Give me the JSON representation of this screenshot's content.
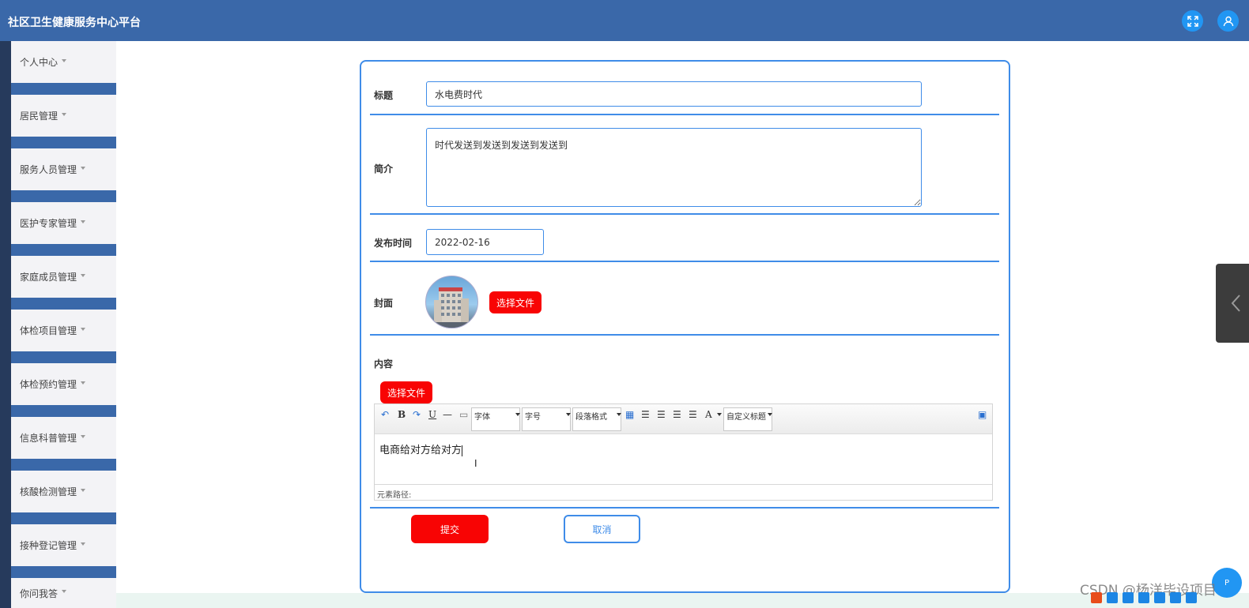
{
  "header": {
    "title": "社区卫生健康服务中心平台"
  },
  "sidebar": {
    "items": [
      {
        "label": "个人中心"
      },
      {
        "label": "居民管理"
      },
      {
        "label": "服务人员管理"
      },
      {
        "label": "医护专家管理"
      },
      {
        "label": "家庭成员管理"
      },
      {
        "label": "体检项目管理"
      },
      {
        "label": "体检预约管理"
      },
      {
        "label": "信息科普管理"
      },
      {
        "label": "核酸检测管理"
      },
      {
        "label": "接种登记管理"
      },
      {
        "label": "你问我答"
      }
    ]
  },
  "form": {
    "title_label": "标题",
    "title_value": "水电费时代",
    "intro_label": "简介",
    "intro_value": "时代发送到发送到发送到发送到",
    "date_label": "发布时间",
    "date_value": "2022-02-16",
    "cover_label": "封面",
    "choose_file_label": "选择文件",
    "content_label": "内容",
    "content_choose_file_label": "选择文件",
    "editor": {
      "font_select": "字体",
      "size_select": "字号",
      "paragraph_select": "段落格式",
      "custom_title_select": "自定义标题",
      "body_text": "电商给对方给对方",
      "path_label": "元素路径:"
    },
    "submit_label": "提交",
    "cancel_label": "取消"
  },
  "watermark": "CSDN @杨洋毕设项目",
  "float_button_label": "P",
  "colors": {
    "header_bg": "#3a68a9",
    "accent_blue": "#3f8ce8",
    "submit_red": "#f80404"
  }
}
